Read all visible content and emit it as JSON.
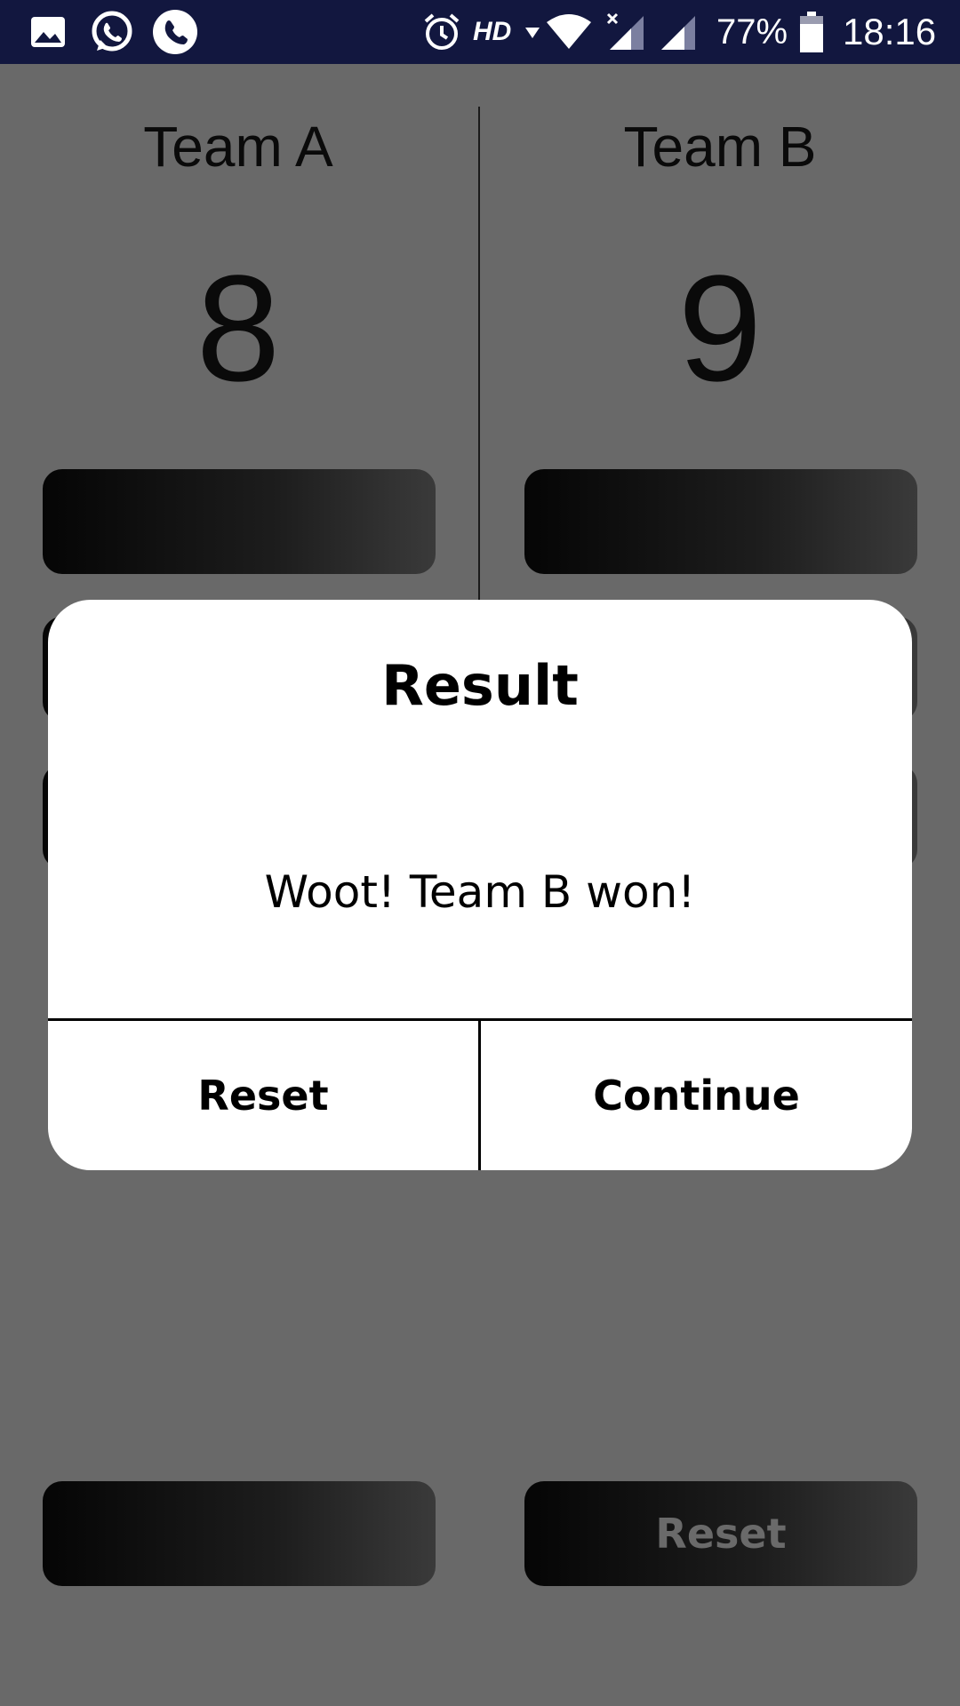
{
  "status_bar": {
    "icons": [
      "gallery-icon",
      "whatsapp-icon",
      "phone-icon",
      "alarm-icon",
      "hd-indicator",
      "wifi-icon",
      "signal-icon",
      "signal-icon",
      "battery-icon"
    ],
    "network_label": "HD",
    "battery_percent": "77%",
    "time": "18:16",
    "background_color": "#12173f"
  },
  "teams": [
    {
      "name": "Team A",
      "score": "8"
    },
    {
      "name": "Team B",
      "score": "9"
    }
  ],
  "bottom": {
    "reset_label": "Reset"
  },
  "dialog": {
    "title": "Result",
    "message": "Woot! Team B won!",
    "reset_label": "Reset",
    "continue_label": "Continue"
  },
  "colors": {
    "screen_dim": "#696969",
    "dialog_bg": "#ffffff"
  }
}
